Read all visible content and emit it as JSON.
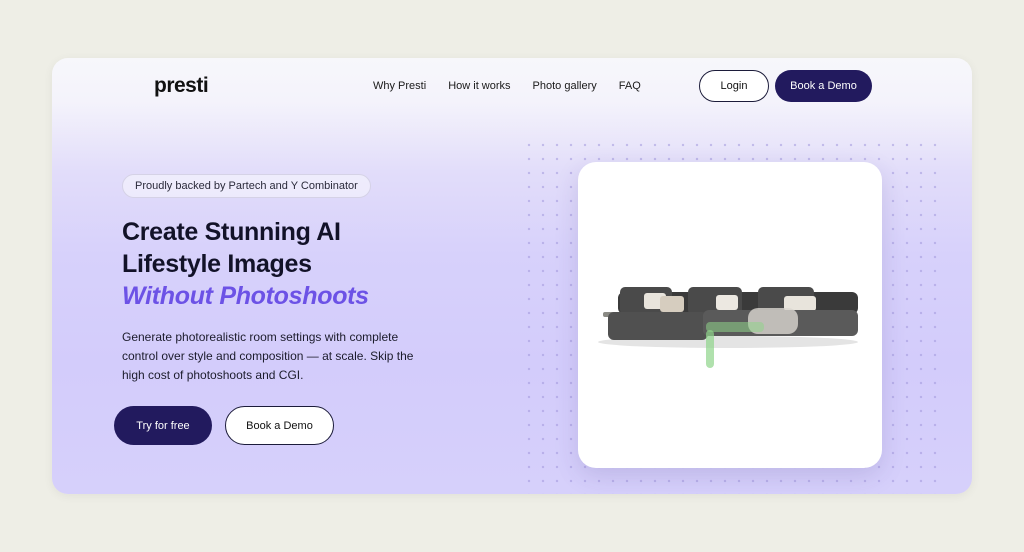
{
  "brand": {
    "logo_text": "presti"
  },
  "nav": {
    "items": [
      {
        "label": "Why Presti"
      },
      {
        "label": "How it works"
      },
      {
        "label": "Photo gallery"
      },
      {
        "label": "FAQ"
      }
    ],
    "login_label": "Login",
    "book_demo_label": "Book a Demo"
  },
  "hero": {
    "badge": "Proudly backed by Partech and Y Combinator",
    "headline_line1": "Create Stunning AI",
    "headline_line2": "Lifestyle Images",
    "headline_accent": "Without Photoshoots",
    "description": "Generate photorealistic room settings with complete control over style and composition — at scale. Skip the high cost of photoshoots and CGI.",
    "cta_primary": "Try for free",
    "cta_secondary": "Book a Demo"
  },
  "colors": {
    "background": "#eeeee6",
    "primary_button": "#221a5e",
    "accent_text": "#6c52e6",
    "hero_gradient": "#d3ccfb"
  },
  "preview": {
    "image": "grey-sectional-sofa-photo"
  }
}
